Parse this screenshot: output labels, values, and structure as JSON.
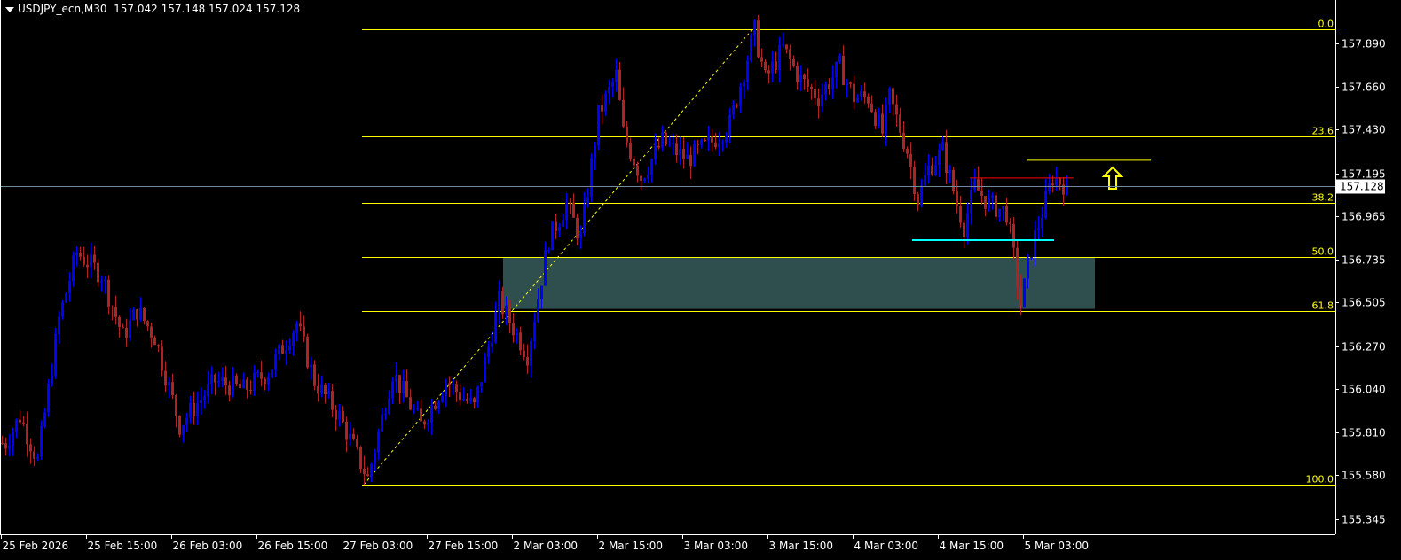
{
  "header": {
    "symbol": "USDJPY_ecn,M30",
    "ohlc": "157.042 157.148 157.024 157.128"
  },
  "colors": {
    "background": "#000000",
    "bull": "#0000ff",
    "bear": "#b22222",
    "fibo": "#ffff00",
    "zone": "#2f4f4f",
    "support": "#00ffff",
    "resistance": "#ff0000",
    "bid_line": "#778899"
  },
  "chart_data": {
    "type": "candlestick",
    "title": "USDJPY_ecn,M30",
    "ylim": [
      155.25,
      158.12
    ],
    "y_ticks": [
      "157.890",
      "157.660",
      "157.430",
      "157.195",
      "156.965",
      "156.735",
      "156.505",
      "156.270",
      "156.040",
      "155.810",
      "155.580",
      "155.345"
    ],
    "x_ticks": [
      "25 Feb 2026",
      "25 Feb 15:00",
      "26 Feb 03:00",
      "26 Feb 15:00",
      "27 Feb 03:00",
      "27 Feb 15:00",
      "2 Mar 03:00",
      "2 Mar 15:00",
      "3 Mar 03:00",
      "3 Mar 15:00",
      "4 Mar 03:00",
      "4 Mar 15:00",
      "5 Mar 03:00"
    ],
    "bars_per_tick": 24,
    "current_price": "157.128",
    "price_path_anchors": [
      [
        1,
        155.753
      ],
      [
        5,
        155.895
      ],
      [
        10,
        155.658
      ],
      [
        16,
        156.416
      ],
      [
        21,
        156.772
      ],
      [
        28,
        156.653
      ],
      [
        34,
        156.321
      ],
      [
        38,
        156.463
      ],
      [
        43,
        156.321
      ],
      [
        50,
        155.847
      ],
      [
        60,
        156.084
      ],
      [
        68,
        156.037
      ],
      [
        75,
        156.132
      ],
      [
        83,
        156.392
      ],
      [
        88,
        156.084
      ],
      [
        95,
        155.895
      ],
      [
        103,
        155.563
      ],
      [
        110,
        156.132
      ],
      [
        118,
        155.847
      ],
      [
        125,
        156.084
      ],
      [
        133,
        155.942
      ],
      [
        140,
        156.511
      ],
      [
        148,
        156.226
      ],
      [
        154,
        156.843
      ],
      [
        159,
        157.032
      ],
      [
        163,
        156.843
      ],
      [
        168,
        157.506
      ],
      [
        173,
        157.719
      ],
      [
        175,
        157.411
      ],
      [
        180,
        157.174
      ],
      [
        186,
        157.364
      ],
      [
        193,
        157.269
      ],
      [
        200,
        157.364
      ],
      [
        205,
        157.459
      ],
      [
        209,
        157.743
      ],
      [
        212,
        157.956
      ],
      [
        215,
        157.696
      ],
      [
        220,
        157.862
      ],
      [
        225,
        157.696
      ],
      [
        230,
        157.601
      ],
      [
        236,
        157.767
      ],
      [
        240,
        157.601
      ],
      [
        244,
        157.601
      ],
      [
        248,
        157.411
      ],
      [
        250,
        157.601
      ],
      [
        255,
        157.317
      ],
      [
        258,
        157.056
      ],
      [
        261,
        157.222
      ],
      [
        265,
        157.317
      ],
      [
        269,
        157.032
      ],
      [
        271,
        156.914
      ],
      [
        274,
        157.127
      ],
      [
        278,
        157.032
      ],
      [
        283,
        156.985
      ],
      [
        285,
        156.748
      ],
      [
        287,
        156.487
      ],
      [
        290,
        156.795
      ],
      [
        293,
        156.985
      ],
      [
        296,
        157.174
      ],
      [
        300,
        157.128
      ]
    ],
    "fibonacci": {
      "high": 157.966,
      "low": 155.53,
      "levels": [
        {
          "label": "0.0",
          "price": 157.966
        },
        {
          "label": "23.6",
          "price": 157.391
        },
        {
          "label": "38.2",
          "price": 157.035
        },
        {
          "label": "50.0",
          "price": 156.748
        },
        {
          "label": "61.8",
          "price": 156.461
        },
        {
          "label": "100.0",
          "price": 155.53
        }
      ]
    },
    "zone": {
      "top": 156.748,
      "bottom": 156.47
    },
    "support_line": 156.838,
    "resistance_line": 157.17,
    "target_line": 157.265,
    "signal": "up-arrow"
  }
}
